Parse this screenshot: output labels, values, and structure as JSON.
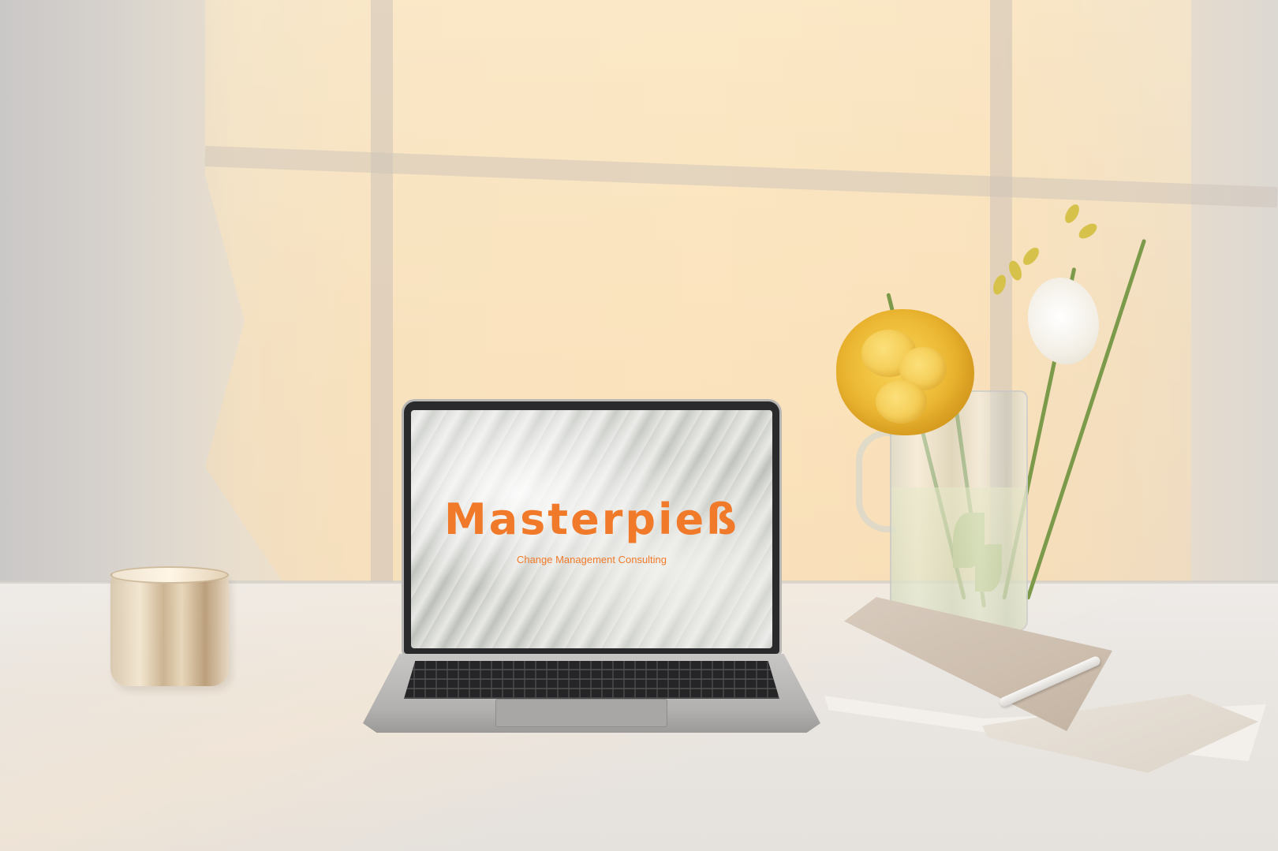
{
  "laptop_screen": {
    "brand_title": "Masterpieß",
    "brand_subtitle": "Change Management Consulting"
  },
  "colors": {
    "brand_accent": "#f07a2a",
    "wall_warm": "#f7e4c4",
    "table": "#ece9e5",
    "rose": "#f0c13e"
  },
  "objects": [
    "candle-glass",
    "laptop",
    "glass-vase",
    "yellow-rose",
    "white-freesia",
    "open-notebook",
    "pen"
  ]
}
